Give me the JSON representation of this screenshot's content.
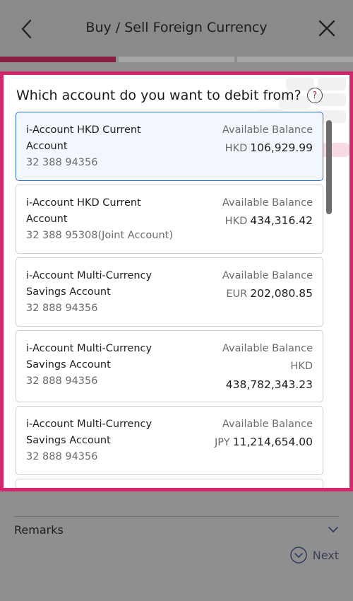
{
  "header": {
    "title": "Buy / Sell Foreign Currency"
  },
  "modal": {
    "question": "Which account do you want to debit from?",
    "help_glyph": "?"
  },
  "accounts": [
    {
      "name": "i-Account HKD Current Account",
      "number": "32 388 94356",
      "balance_label": "Available Balance",
      "currency": "HKD",
      "amount": "106,929.99",
      "selected": true
    },
    {
      "name": "i-Account HKD Current Account",
      "number": "32 388 95308(Joint Account)",
      "balance_label": "Available Balance",
      "currency": "HKD",
      "amount": "434,316.42",
      "selected": false
    },
    {
      "name": "i-Account Multi-Currency Savings Account",
      "number": "32 888 94356",
      "balance_label": "Available Balance",
      "currency": "EUR",
      "amount": "202,080.85",
      "selected": false
    },
    {
      "name": "i-Account Multi-Currency Savings Account",
      "number": "32 888 94356",
      "balance_label": "Available Balance",
      "currency": "HKD",
      "amount": "438,782,343.23",
      "selected": false
    },
    {
      "name": "i-Account Multi-Currency Savings Account",
      "number": "32 888 94356",
      "balance_label": "Available Balance",
      "currency": "JPY",
      "amount": "11,214,654.00",
      "selected": false
    }
  ],
  "form": {
    "remarks_label": "Remarks",
    "next_label": "Next"
  },
  "colors": {
    "highlight": "#d4266a",
    "progress_active": "#8a1f45",
    "selected_border": "#2b6fcf"
  },
  "icons": [
    "back-icon",
    "close-icon",
    "help-icon",
    "chevron-down-icon",
    "next-circle-icon"
  ]
}
